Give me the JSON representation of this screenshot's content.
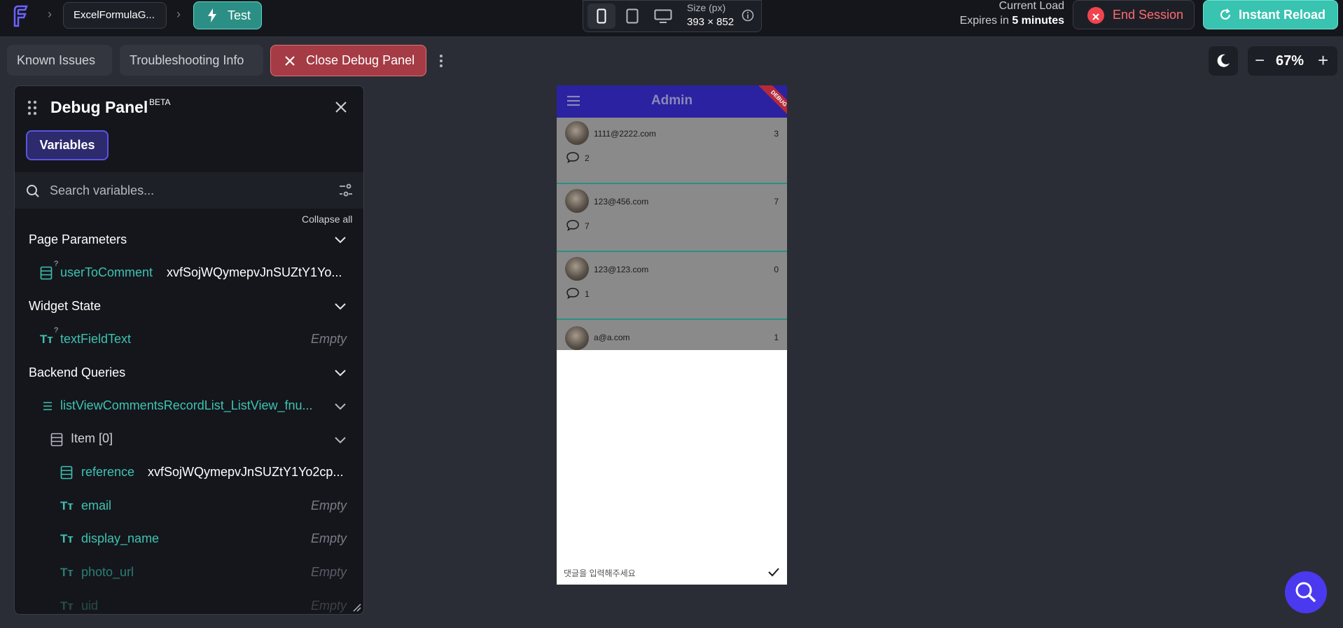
{
  "topbar": {
    "project_name": "ExcelFormulaG...",
    "test_label": "Test",
    "size_label": "Size (px)",
    "size_value": "393 × 852",
    "load_label": "Current Load",
    "expires_prefix": "Expires in",
    "expires_value": "5 minutes",
    "end_session_label": "End Session",
    "instant_reload_label": "Instant Reload",
    "selected_device": "mobile"
  },
  "toolbar": {
    "known_issues": "Known Issues",
    "troubleshooting": "Troubleshooting Info",
    "close_debug": "Close Debug Panel",
    "zoom": "67%"
  },
  "debug_panel": {
    "title": "Debug Panel",
    "beta": "BETA",
    "tab": "Variables",
    "search_placeholder": "Search variables...",
    "collapse_all": "Collapse all",
    "sections": {
      "page_params": "Page Parameters",
      "widget_state": "Widget State",
      "backend_queries": "Backend Queries"
    },
    "vars": {
      "user_to_comment": {
        "name": "userToComment",
        "value": "xvfSojWQymepvJnSUZtY1Yo..."
      },
      "text_field_text": {
        "name": "textFieldText",
        "value": "Empty"
      },
      "list_query": {
        "name": "listViewCommentsRecordList_ListView_fnu..."
      },
      "item": "Item [0]",
      "reference": {
        "name": "reference",
        "value": "xvfSojWQymepvJnSUZtY1Yo2cp..."
      },
      "email": {
        "name": "email",
        "value": "Empty"
      },
      "display_name": {
        "name": "display_name",
        "value": "Empty"
      },
      "photo_url": {
        "name": "photo_url",
        "value": "Empty"
      },
      "uid": {
        "name": "uid",
        "value": "Empty"
      }
    }
  },
  "phone": {
    "title": "Admin",
    "debug_ribbon": "DEBUG",
    "items": [
      {
        "email": "1111@2222.com",
        "count": "3",
        "comments": "2"
      },
      {
        "email": "123@456.com",
        "count": "7",
        "comments": "7"
      },
      {
        "email": "123@123.com",
        "count": "0",
        "comments": "1"
      },
      {
        "email": "a@a.com",
        "count": "1",
        "comments": ""
      }
    ],
    "comment_placeholder": "댓글을 입력해주세요"
  },
  "colors": {
    "accent_teal": "#39c3b1",
    "danger": "#f0444f",
    "appbar": "#2a22a0",
    "primary": "#4b39ef"
  }
}
